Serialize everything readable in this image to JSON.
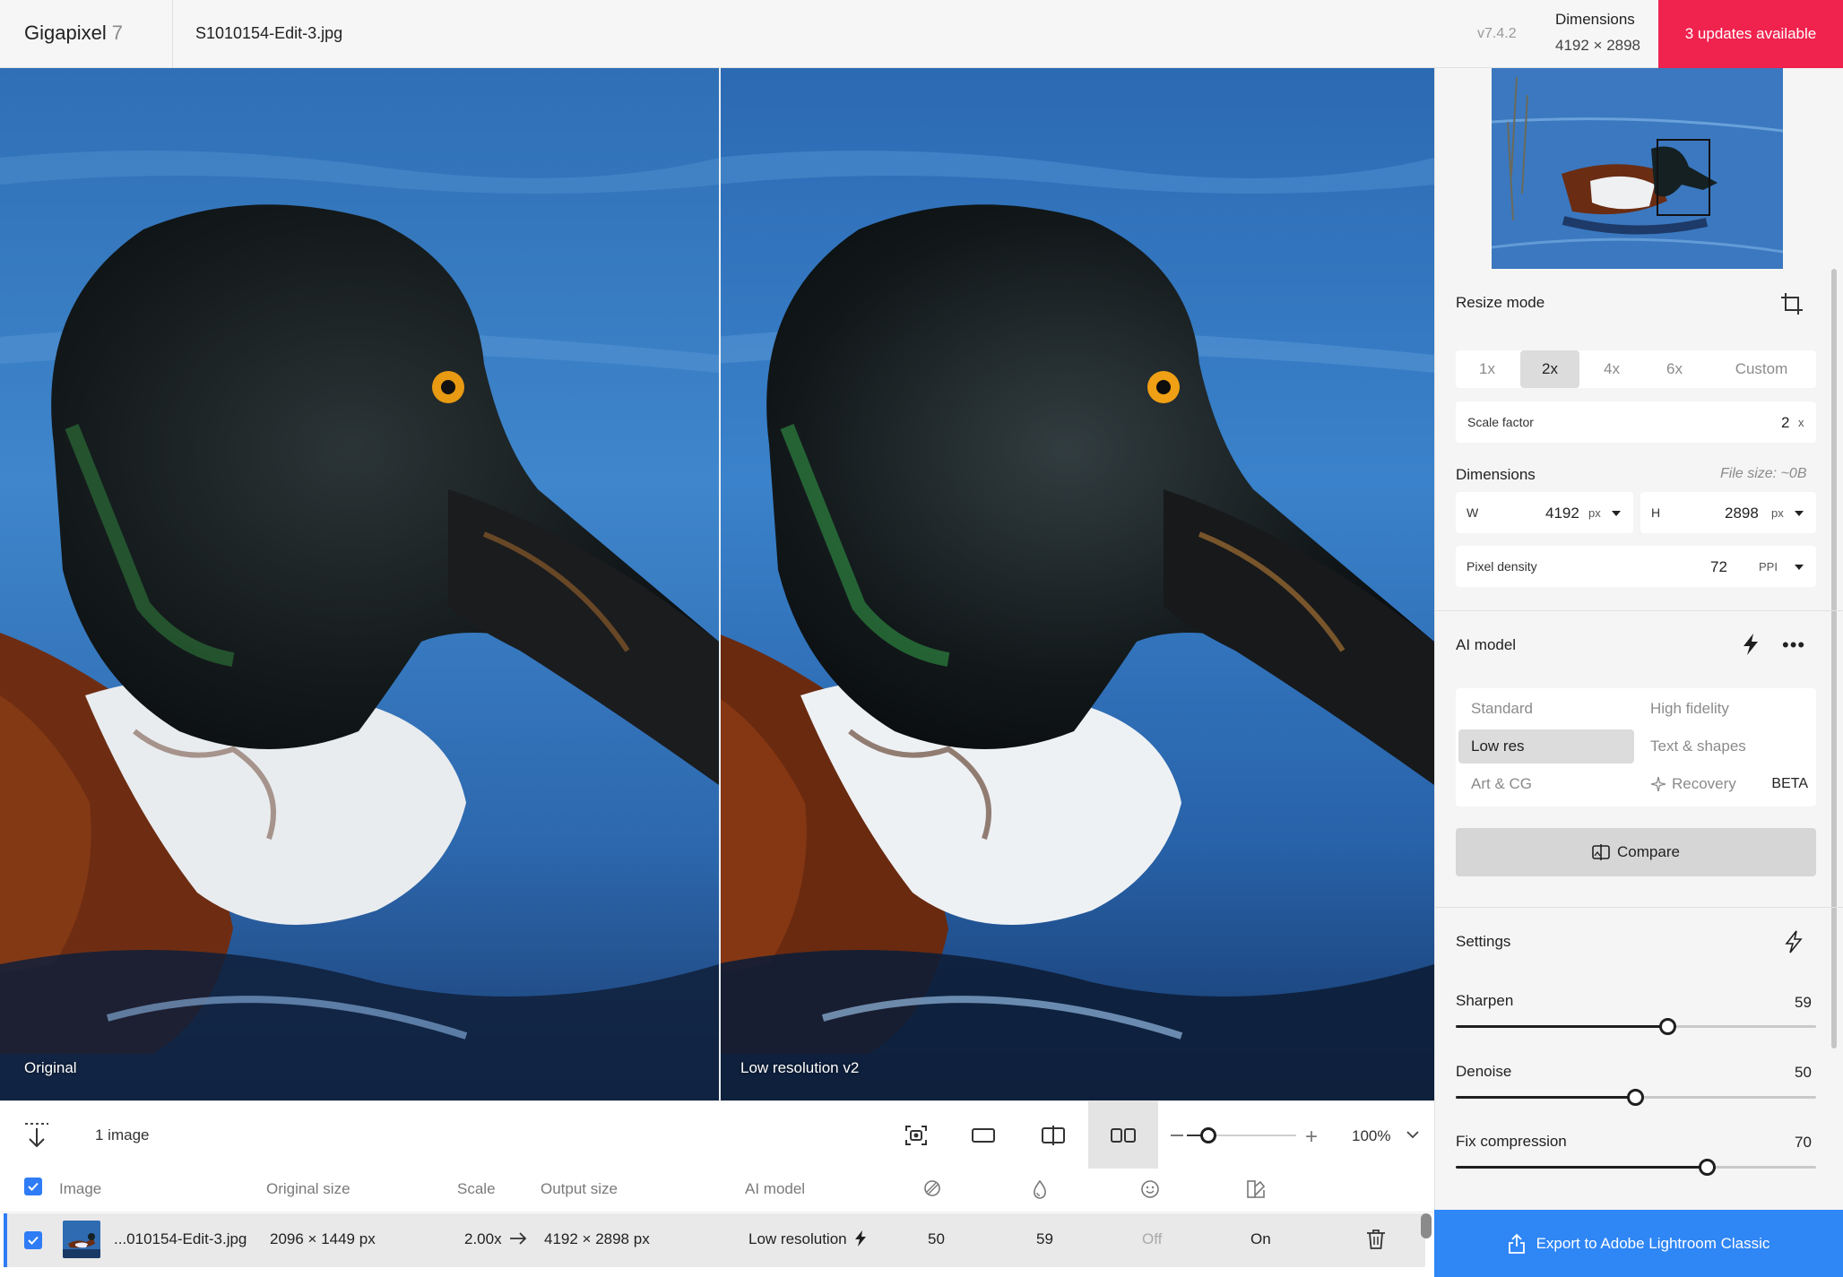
{
  "header": {
    "app_name": "Gigapixel",
    "app_version": "7",
    "file_name": "S1010154-Edit-3.jpg",
    "build_version": "v7.4.2",
    "dimensions_label": "Dimensions",
    "dimensions_value": "4192 × 2898",
    "updates_label": "3 updates available"
  },
  "viewer": {
    "left_label": "Original",
    "right_label": "Low resolution v2"
  },
  "toolbar": {
    "image_count": "1 image",
    "view_buttons": [
      "screenshot-icon",
      "single-view-icon",
      "split-view-icon",
      "side-by-side-icon"
    ],
    "active_view": "side-by-side",
    "zoom_level_text": "100%",
    "zoom_slider_fraction": 0.2
  },
  "table": {
    "columns": {
      "image": "Image",
      "original_size": "Original size",
      "scale": "Scale",
      "output_size": "Output size",
      "ai_model": "AI model",
      "icon_cols": [
        "fix-compression-icon",
        "sharpen-icon",
        "face-recovery-icon",
        "color-correction-icon"
      ]
    },
    "rows": [
      {
        "checked": true,
        "name": "...010154-Edit-3.jpg",
        "original_size": "2096 × 1449 px",
        "scale": "2.00x",
        "output_size": "4192 × 2898 px",
        "ai_model": "Low resolution",
        "v1": "50",
        "v2": "59",
        "v3": "Off",
        "v4": "On"
      }
    ]
  },
  "sidebar": {
    "resize": {
      "title": "Resize mode",
      "options": [
        "1x",
        "2x",
        "4x",
        "6x",
        "Custom"
      ],
      "active": "2x",
      "scale_label": "Scale factor",
      "scale_value": "2",
      "scale_unit": "x"
    },
    "dimensions": {
      "title": "Dimensions",
      "file_size": "File size: ~0B",
      "w_label": "W",
      "w_value": "4192",
      "h_label": "H",
      "h_value": "2898",
      "unit": "px",
      "density_label": "Pixel density",
      "density_value": "72",
      "density_unit": "PPI"
    },
    "ai_model": {
      "title": "AI model",
      "items": [
        "Standard",
        "High fidelity",
        "Low res",
        "Text & shapes",
        "Art & CG",
        "Recovery"
      ],
      "active": "Low res",
      "beta": "BETA",
      "compare_label": "Compare"
    },
    "settings": {
      "title": "Settings",
      "sliders": [
        {
          "label": "Sharpen",
          "value": "59",
          "fraction": 0.59
        },
        {
          "label": "Denoise",
          "value": "50",
          "fraction": 0.5
        },
        {
          "label": "Fix compression",
          "value": "70",
          "fraction": 0.7
        }
      ]
    },
    "export_label": "Export to Adobe Lightroom Classic"
  },
  "colors": {
    "accent_blue": "#2f86f5",
    "updates_red": "#f0224e"
  }
}
